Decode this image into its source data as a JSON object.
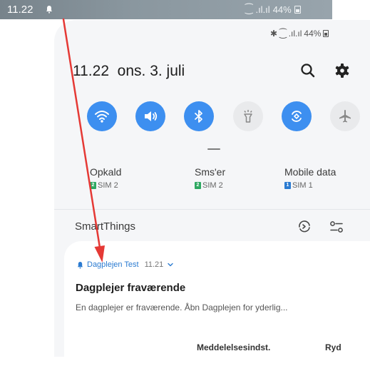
{
  "status_bar": {
    "time": "11.22",
    "battery": "44%",
    "icons": [
      "bell-icon",
      "wifi-call-icon",
      "signal-icon",
      "battery-icon"
    ]
  },
  "panel": {
    "battery": "44%",
    "date_line": "11.22  ons. 3. juli",
    "actions": [
      "search-icon",
      "gear-icon"
    ],
    "quick_toggles": [
      {
        "icon": "wifi-icon",
        "state": "on"
      },
      {
        "icon": "sound-icon",
        "state": "on"
      },
      {
        "icon": "bluetooth-icon",
        "state": "on"
      },
      {
        "icon": "flashlight-icon",
        "state": "off"
      },
      {
        "icon": "auto-rotate-icon",
        "state": "on"
      },
      {
        "icon": "airplane-icon",
        "state": "off"
      }
    ],
    "sim_settings": [
      {
        "title": "Opkald",
        "sim": "SIM 2",
        "badge": "2",
        "color": "#2ea861"
      },
      {
        "title": "Sms'er",
        "sim": "SIM 2",
        "badge": "2",
        "color": "#2ea861"
      },
      {
        "title": "Mobile data",
        "sim": "SIM 1",
        "badge": "1",
        "color": "#2b7bd1"
      }
    ],
    "smartthings_label": "SmartThings"
  },
  "notification": {
    "app": "Dagplejen Test",
    "time": "11.21",
    "title": "Dagplejer fraværende",
    "text": "En dagplejer er fraværende. Åbn Dagplejen for yderlig...",
    "button_settings": "Meddelelsesindst.",
    "button_clear": "Ryd"
  },
  "colors": {
    "accent": "#3d8ff0",
    "annotation_arrow": "#e53935"
  }
}
